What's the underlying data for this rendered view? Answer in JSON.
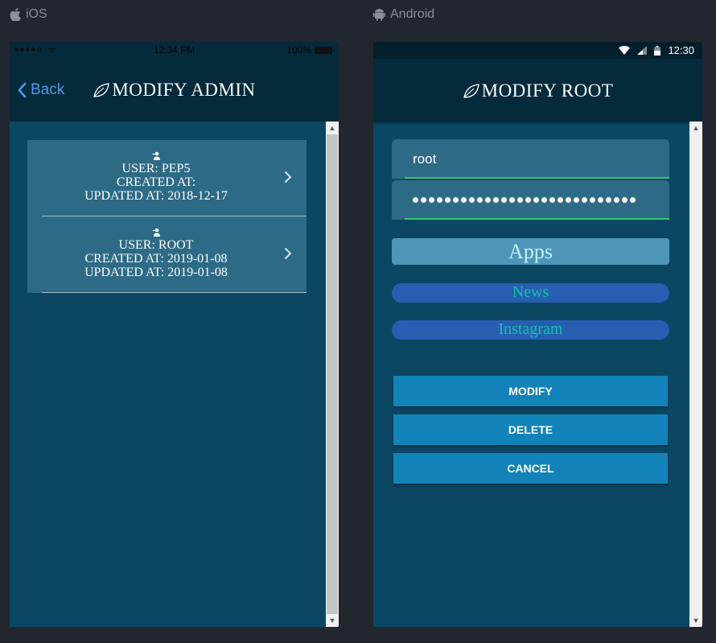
{
  "platforms": {
    "ios_label": "iOS",
    "android_label": "Android"
  },
  "ios": {
    "status": {
      "time": "12:34 PM",
      "battery": "100%"
    },
    "header": {
      "back_label": "Back",
      "title": "MODIFY ADMIN"
    },
    "admins": [
      {
        "user": "USER: PEP5",
        "created": "CREATED AT:",
        "updated": "UPDATED AT: 2018-12-17"
      },
      {
        "user": "USER: ROOT",
        "created": "CREATED AT: 2019-01-08",
        "updated": "UPDATED AT: 2019-01-08"
      }
    ]
  },
  "android": {
    "status": {
      "time": "12:30"
    },
    "header": {
      "title": "MODIFY ROOT"
    },
    "form": {
      "username_value": "root",
      "password_mask_count": 28,
      "apps_label": "Apps",
      "news_label": "News",
      "instagram_label": "Instagram",
      "modify_label": "MODIFY",
      "delete_label": "DELETE",
      "cancel_label": "CANCEL"
    }
  },
  "colors": {
    "background": "#22262e",
    "screen": "#0b4763",
    "header": "#042a3b",
    "accent_green": "#2ecc71",
    "button_blue": "#1283b8",
    "pill_blue": "#265eb2",
    "pill_text": "#10c7a6",
    "ios_link": "#4a9dea"
  },
  "icons": [
    "apple-icon",
    "android-icon",
    "leaf-icon",
    "back-chevron-icon",
    "user-icon",
    "chevron-right-icon",
    "wifi-icon",
    "signal-icon",
    "battery-icon"
  ]
}
